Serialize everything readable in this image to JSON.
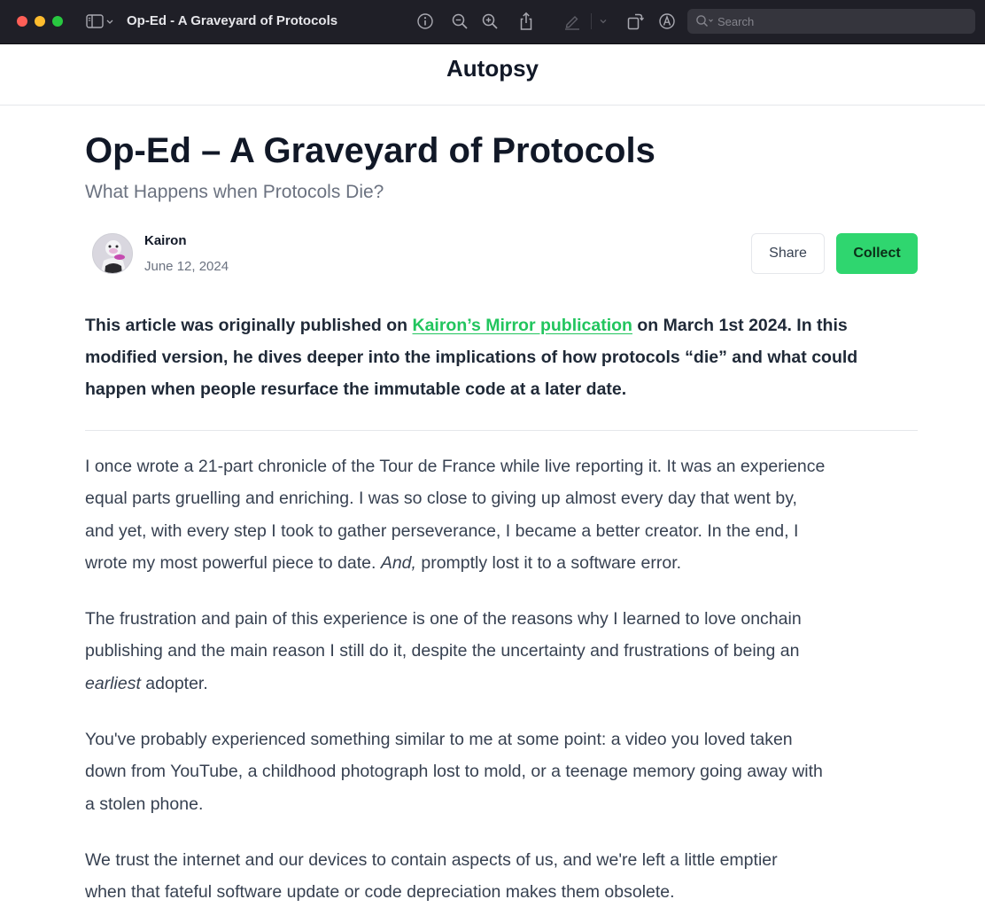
{
  "window": {
    "title": "Op-Ed - A Graveyard of Protocols",
    "search_placeholder": "Search",
    "toolbar_icons": [
      "sidebar-icon",
      "chevron-down-icon",
      "info-icon",
      "zoom-out-icon",
      "zoom-in-icon",
      "share-icon",
      "highlight-icon",
      "chevron-down-icon",
      "rotate-icon",
      "markup-icon",
      "search-icon"
    ]
  },
  "publication": {
    "name": "Autopsy"
  },
  "article": {
    "title": "Op-Ed – A Graveyard of Protocols",
    "subtitle": "What Happens when Protocols Die?",
    "author": "Kairon",
    "date": "June 12, 2024",
    "share_label": "Share",
    "collect_label": "Collect",
    "intro": {
      "line1_before": "This article was originally published on ",
      "link_text": "Kairon’s Mirror publication",
      "line1_after": " on March 1st 2024. In this",
      "line2": "modified version, he dives deeper into the implications of how protocols “die” and what could",
      "line3": "happen when people resurface the immutable code at a later date."
    },
    "paragraphs": {
      "p1": {
        "line1": "I once wrote a 21-part chronicle of the Tour de France while live reporting it. It was an experience",
        "line2": "equal parts gruelling and enriching. I was so close to giving up almost every day that went by,",
        "line3": "and yet, with every step I took to gather perseverance, I became a better creator. In the end, I",
        "line4_before": "wrote my most powerful piece to date. ",
        "line4_em": "And,",
        "line4_after": " promptly lost it to a software error."
      },
      "p2": {
        "line1": "The frustration and pain of this experience is one of the reasons why I learned to love onchain",
        "line2": "publishing and the main reason I still do it, despite the uncertainty and frustrations of being an",
        "line3_em": "earliest",
        "line3_after": " adopter."
      },
      "p3": {
        "line1": "You've probably experienced something similar to me at some point: a video you loved taken",
        "line2": "down from YouTube, a childhood photograph lost to mold, or a teenage memory going away with",
        "line3": "a stolen phone."
      },
      "p4": {
        "line1": "We trust the internet and our devices to contain aspects of us, and we're left a little emptier",
        "line2": "when that fateful software update or code depreciation makes them obsolete."
      }
    }
  },
  "colors": {
    "titlebar": "#1f1f27",
    "accent_green": "#2fd66f",
    "link_green": "#22c55e",
    "heading": "#111827",
    "muted": "#6b7280"
  }
}
